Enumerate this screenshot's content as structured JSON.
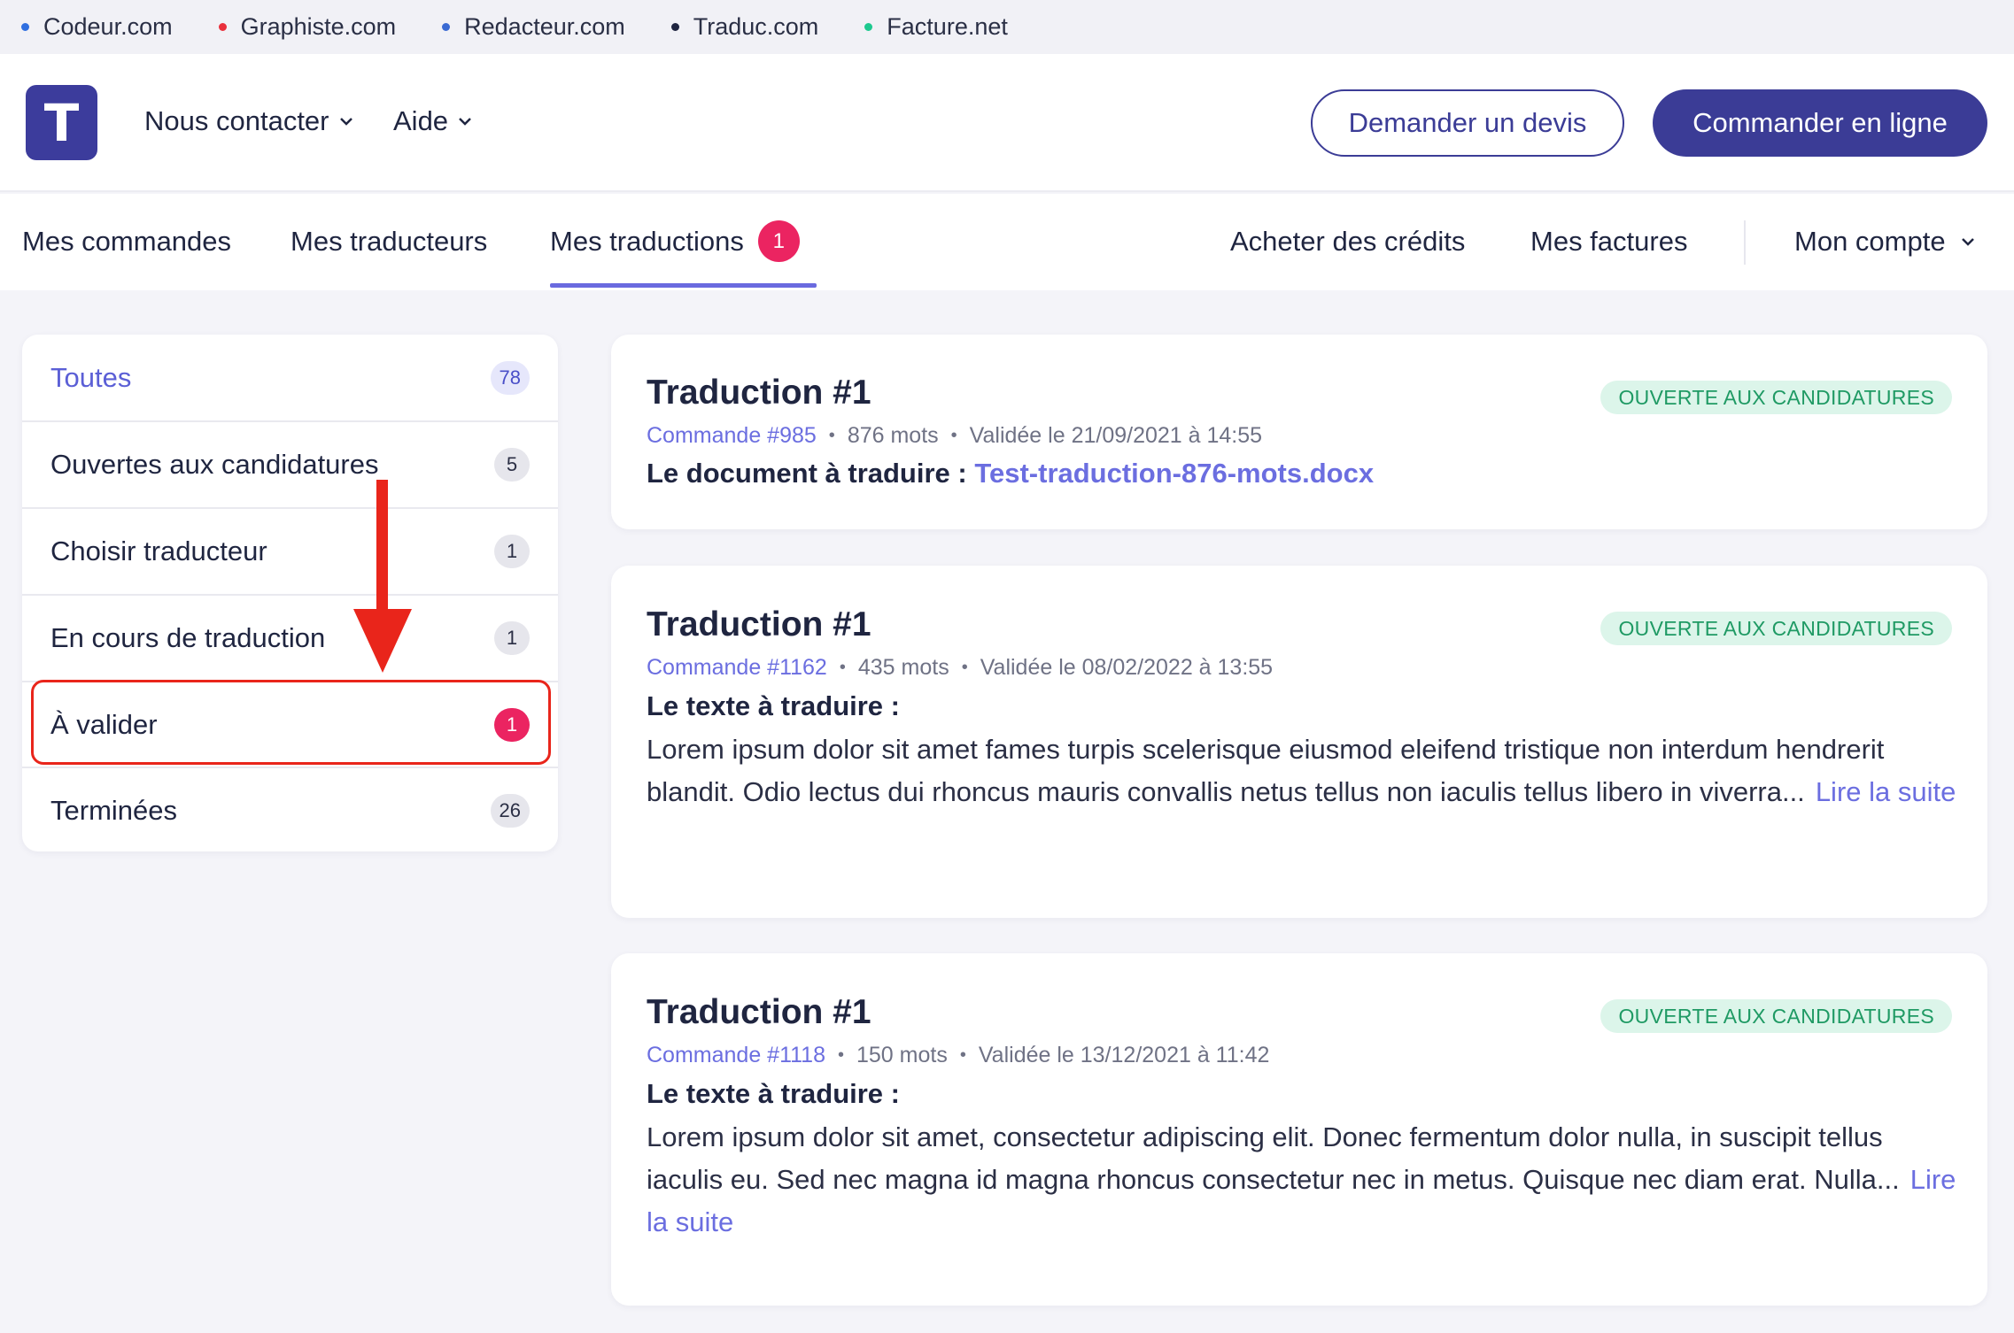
{
  "network": {
    "items": [
      {
        "label": "Codeur.com",
        "color": "#2f6fe0"
      },
      {
        "label": "Graphiste.com",
        "color": "#e9303c"
      },
      {
        "label": "Redacteur.com",
        "color": "#3a6ad3"
      },
      {
        "label": "Traduc.com",
        "color": "#1f2540"
      },
      {
        "label": "Facture.net",
        "color": "#1ec98f"
      }
    ]
  },
  "header": {
    "logo_letter": "T",
    "nav": {
      "contact": "Nous contacter",
      "help": "Aide"
    },
    "quote_button": "Demander un devis",
    "order_button": "Commander en ligne"
  },
  "tabs": {
    "orders": "Mes commandes",
    "translators": "Mes traducteurs",
    "translations": "Mes traductions",
    "translations_badge": "1",
    "credits": "Acheter des crédits",
    "invoices": "Mes factures",
    "account": "Mon compte"
  },
  "sidebar": {
    "items": [
      {
        "label": "Toutes",
        "count": "78"
      },
      {
        "label": "Ouvertes aux candidatures",
        "count": "5"
      },
      {
        "label": "Choisir traducteur",
        "count": "1"
      },
      {
        "label": "En cours de traduction",
        "count": "1"
      },
      {
        "label": "À valider",
        "count": "1"
      },
      {
        "label": "Terminées",
        "count": "26"
      }
    ]
  },
  "cards": [
    {
      "title": "Traduction #1",
      "status": "OUVERTE AUX CANDIDATURES",
      "order": "Commande #985",
      "words": "876 mots",
      "validated": "Validée le 21/09/2021 à 14:55",
      "doc_label": "Le document à traduire :",
      "doc_name": "Test-traduction-876-mots.docx"
    },
    {
      "title": "Traduction #1",
      "status": "OUVERTE AUX CANDIDATURES",
      "order": "Commande #1162",
      "words": "435 mots",
      "validated": "Validée le 08/02/2022 à 13:55",
      "text_label": "Le texte à traduire :",
      "text": "Lorem ipsum dolor sit amet fames turpis scelerisque eiusmod eleifend tristique non interdum hendrerit blandit. Odio lectus dui rhoncus mauris convallis netus tellus non iaculis tellus libero in viverra...",
      "more": "Lire la suite"
    },
    {
      "title": "Traduction #1",
      "status": "OUVERTE AUX CANDIDATURES",
      "order": "Commande #1118",
      "words": "150 mots",
      "validated": "Validée le 13/12/2021 à 11:42",
      "text_label": "Le texte à traduire :",
      "text": "Lorem ipsum dolor sit amet, consectetur adipiscing elit. Donec fermentum dolor nulla, in suscipit tellus iaculis eu. Sed nec magna id magna rhoncus consectetur nec in metus. Quisque nec diam erat. Nulla...",
      "more": "Lire la suite"
    }
  ],
  "colors": {
    "accent": "#3b3c96",
    "highlight": "#e9251b",
    "badge": "#eb2461",
    "status_bg": "#dcf5ea",
    "status_text": "#1f9a64"
  }
}
